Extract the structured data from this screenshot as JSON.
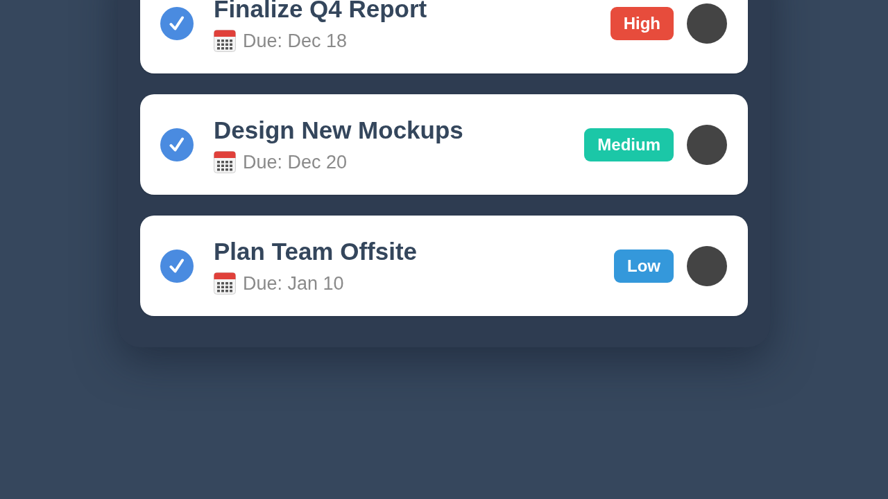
{
  "tasks": [
    {
      "done": true,
      "title": "Finalize Q4 Report",
      "due": "Due: Dec 18",
      "priority": {
        "label": "High",
        "color": "#e74c3c"
      }
    },
    {
      "done": true,
      "title": "Design New Mockups",
      "due": "Due: Dec 20",
      "priority": {
        "label": "Medium",
        "color": "#1bc7a7"
      }
    },
    {
      "done": true,
      "title": "Plan Team Offsite",
      "due": "Due: Jan 10",
      "priority": {
        "label": "Low",
        "color": "#3498db"
      }
    }
  ]
}
